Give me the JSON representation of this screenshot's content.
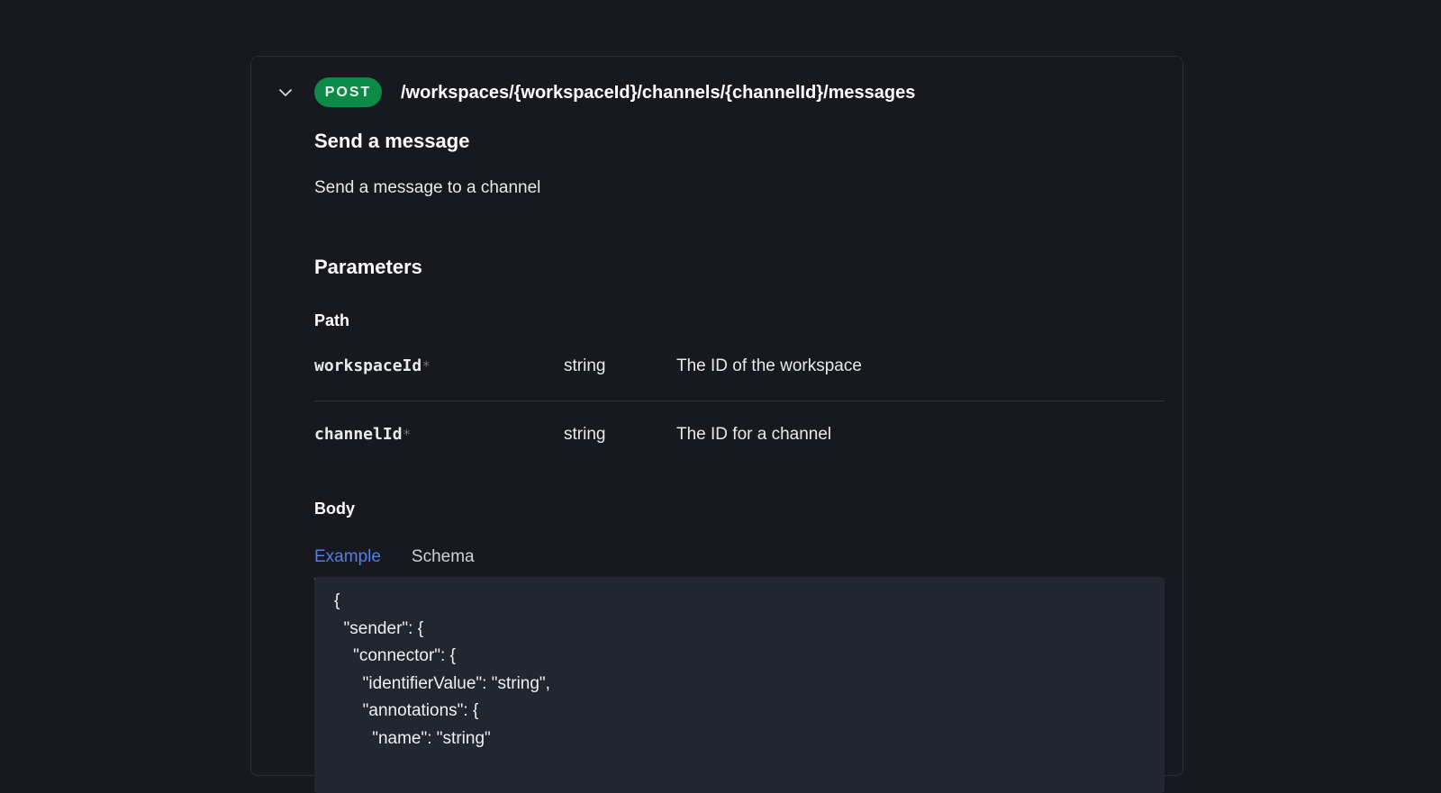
{
  "operation": {
    "method": "POST",
    "path": "/workspaces/{workspaceId}/channels/{channelId}/messages",
    "title": "Send a message",
    "description": "Send a message to a channel"
  },
  "parameters": {
    "heading": "Parameters",
    "path_heading": "Path",
    "required_marker": "*",
    "path_params": [
      {
        "name": "workspaceId",
        "type": "string",
        "description": "The ID of the workspace"
      },
      {
        "name": "channelId",
        "type": "string",
        "description": "The ID for a channel"
      }
    ]
  },
  "body": {
    "heading": "Body",
    "tabs": [
      {
        "label": "Example",
        "active": true
      },
      {
        "label": "Schema",
        "active": false
      }
    ],
    "example_lines": [
      "{",
      "  \"sender\": {",
      "    \"connector\": {",
      "      \"identifierValue\": \"string\",",
      "      \"annotations\": {",
      "        \"name\": \"string\""
    ]
  },
  "icons": {
    "collapse": "chevron-down-icon"
  },
  "colors": {
    "background": "#18191e",
    "post_badge": "#0c8a47",
    "accent": "#4f7ef0",
    "code_background": "#22262e"
  }
}
